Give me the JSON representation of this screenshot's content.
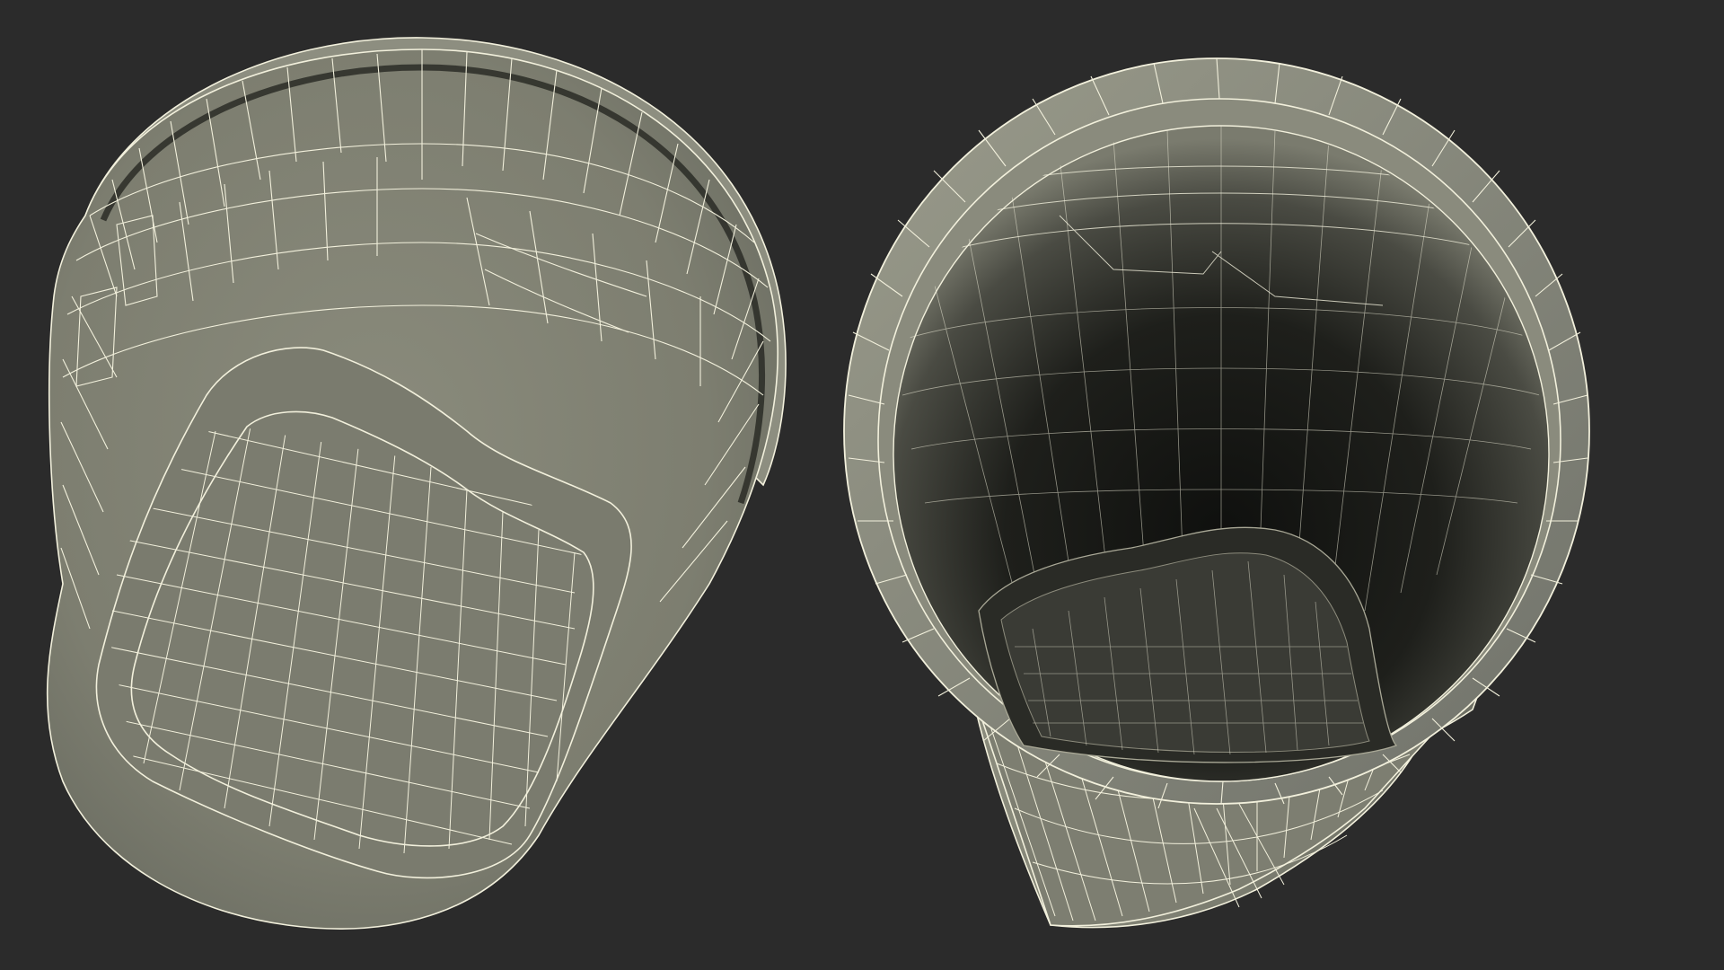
{
  "scene": {
    "description_visible_text": "",
    "colors": {
      "background": "#2b2b2b",
      "surface_light": "#8a8b7c",
      "surface_mid": "#74766a",
      "wire": "#f2f0dc",
      "interior_dark": "#141512"
    },
    "views": [
      {
        "id": "bottom-view",
        "subject": "cup-exterior-bottom",
        "wireframe": true
      },
      {
        "id": "top-view",
        "subject": "cup-interior-top",
        "wireframe": true
      }
    ]
  }
}
